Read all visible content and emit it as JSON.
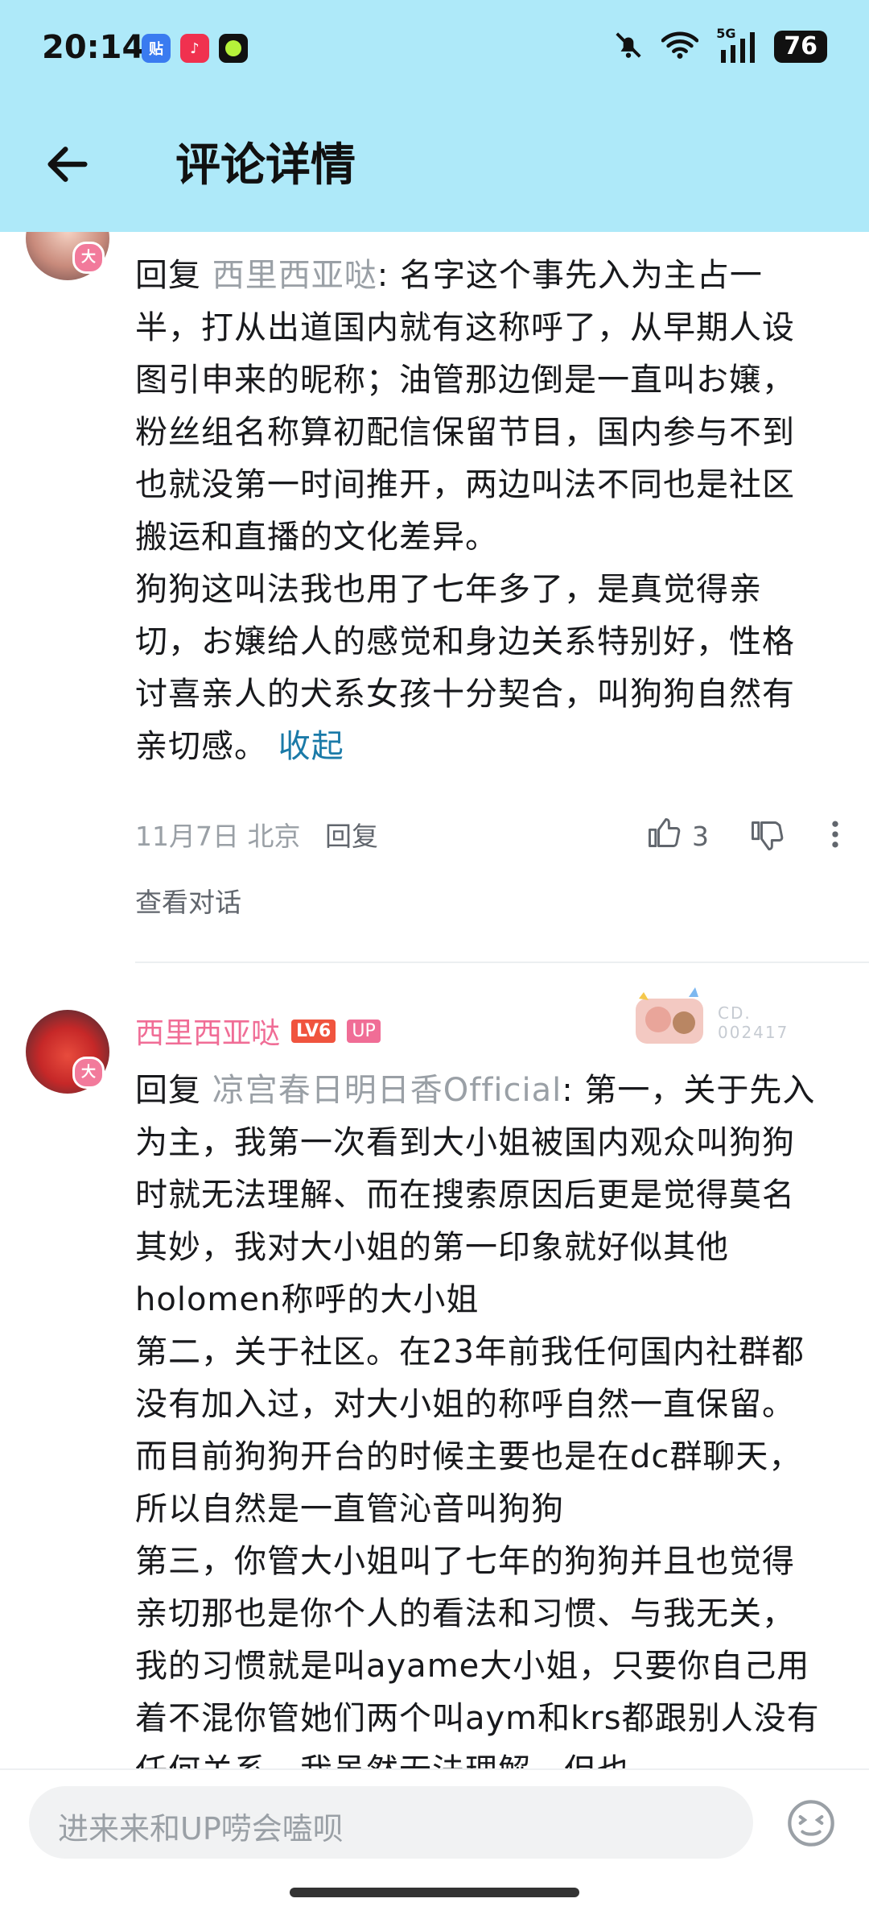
{
  "status_bar": {
    "time": "20:14",
    "battery": "76",
    "network": "5G",
    "app_icons": [
      "tieba-icon",
      "music-icon",
      "green-app-icon"
    ]
  },
  "header": {
    "title": "评论详情"
  },
  "comment1": {
    "reply_prefix": "回复 ",
    "reply_to": "西里西亚哒",
    "text_p1": ": 名字这个事先入为主占一半，打从出道国内就有这称呼了，从早期人设图引申来的昵称；油管那边倒是一直叫お嬢，粉丝组名称算初配信保留节目，国内参与不到也就没第一时间推开，两边叫法不同也是社区搬运和直播的文化差异。",
    "text_p2": "狗狗这叫法我也用了七年多了，是真觉得亲切，お嬢给人的感觉和身边关系特别好，性格讨喜亲人的犬系女孩十分契合，叫狗狗自然有亲切感。",
    "collapse": "收起",
    "date": "11月7日",
    "location": "北京",
    "reply_label": "回复",
    "likes": "3",
    "view_conversation": "查看对话"
  },
  "comment2": {
    "username": "西里西亚哒",
    "level": "LV6",
    "up_badge": "UP",
    "fan_badge_text": "CD.",
    "fan_badge_number": "002417",
    "reply_prefix": "回复 ",
    "reply_to": "凉宫春日明日香Official",
    "text_p1": ": 第一，关于先入为主，我第一次看到大小姐被国内观众叫狗狗时就无法理解、而在搜索原因后更是觉得莫名其妙，我对大小姐的第一印象就好似其他holomen称呼的大小姐",
    "text_p2": "第二，关于社区。在23年前我任何国内社群都没有加入过，对大小姐的称呼自然一直保留。而目前狗狗开台的时候主要也是在dc群聊天，所以自然是一直管沁音叫狗狗",
    "text_p3": "第三，你管大小姐叫了七年的狗狗并且也觉得亲切那也是你个人的看法和习惯、与我无关，我的习惯就是叫ayame大小姐，只要你自己用着不混你管她们两个叫aym和krs都跟别人没有任何关系，我虽然无法理解，但也"
  },
  "input": {
    "placeholder": "进来来和UP唠会嗑呗"
  },
  "colors": {
    "header_bg": "#aee9f9",
    "username_pink": "#f06d96",
    "link_blue": "#1a7aa8"
  }
}
